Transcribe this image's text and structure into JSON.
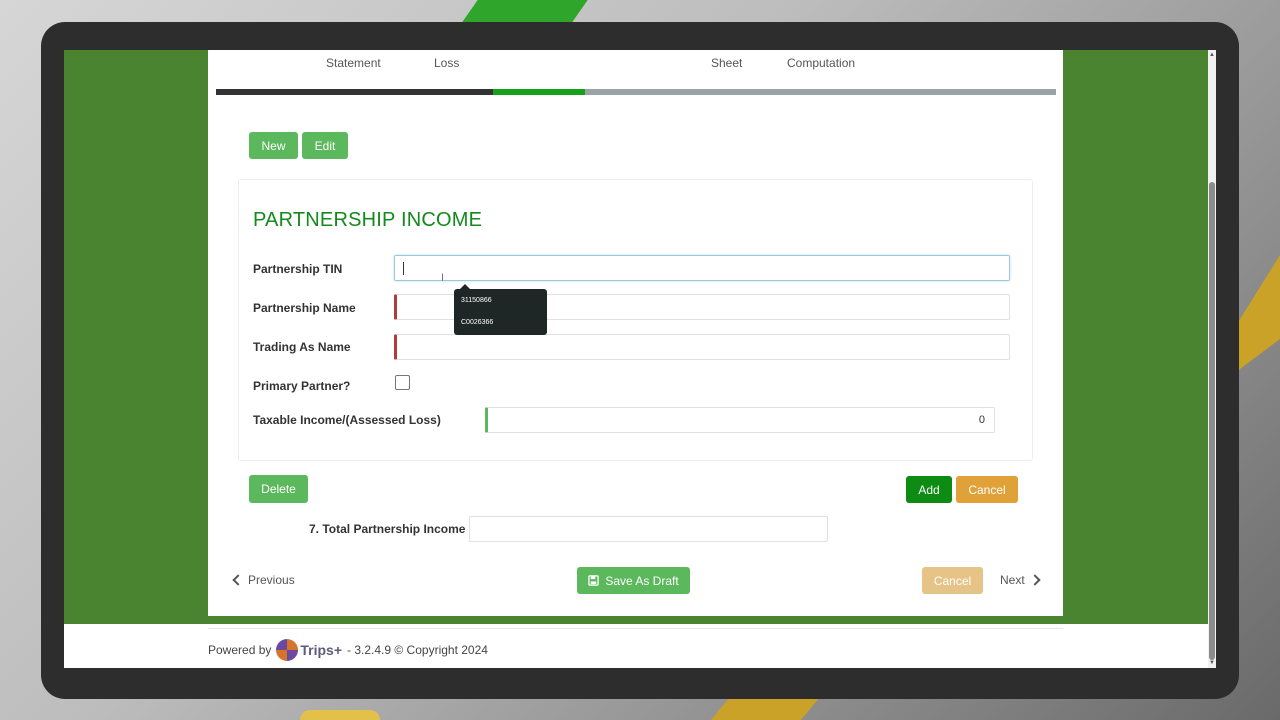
{
  "wizard": {
    "steps": [
      "Statement",
      "Loss",
      "Sheet",
      "Computation"
    ]
  },
  "toolbar": {
    "new_label": "New",
    "edit_label": "Edit"
  },
  "section": {
    "title": "PARTNERSHIP INCOME"
  },
  "form": {
    "tin_label": "Partnership TIN",
    "tin_value": "",
    "name_label": "Partnership Name",
    "trading_label": "Trading As Name",
    "primary_label": "Primary Partner?",
    "taxable_label": "Taxable Income/(Assessed Loss)",
    "taxable_value": "0"
  },
  "autocomplete": {
    "options": [
      "31150866",
      "C0026366"
    ]
  },
  "actions": {
    "delete_label": "Delete",
    "add_label": "Add",
    "cancel_label": "Cancel"
  },
  "total": {
    "label": "7. Total Partnership Income",
    "value": ""
  },
  "nav": {
    "previous_label": "Previous",
    "save_draft_label": "Save As Draft",
    "cancel_label": "Cancel",
    "next_label": "Next"
  },
  "footer": {
    "powered_by": "Powered by",
    "brand": "Trips+",
    "version": "- 3.2.4.9 © Copyright 2024"
  }
}
